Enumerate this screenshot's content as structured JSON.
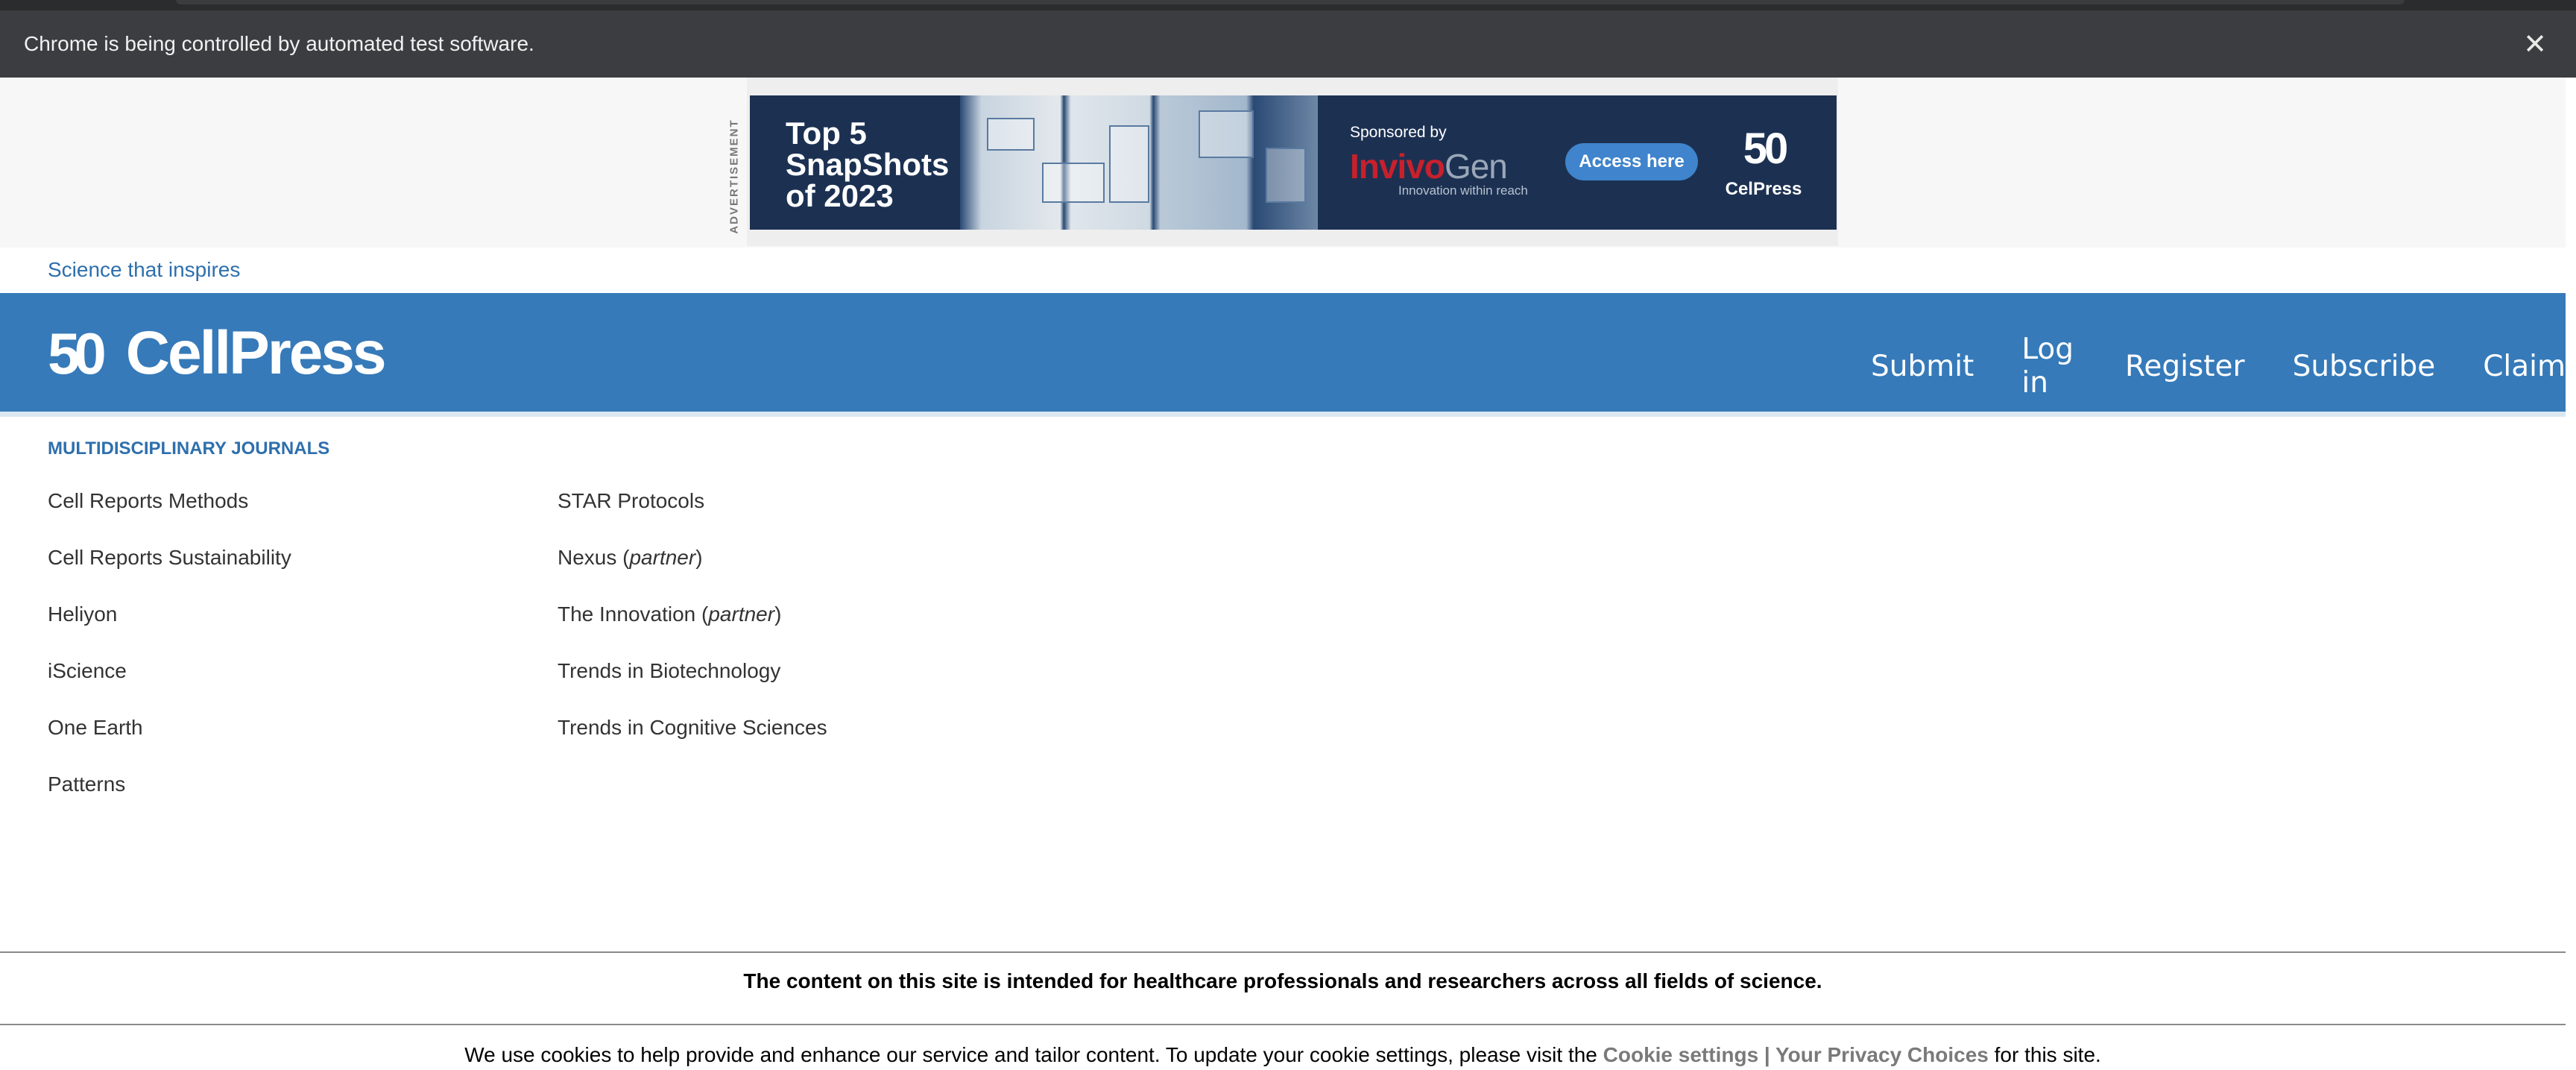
{
  "infobar": {
    "message": "Chrome is being controlled by automated test software.",
    "close_icon": "✕"
  },
  "advertisement": {
    "label": "ADVERTISEMENT",
    "headline": "Top 5 SnapShots of 2023",
    "sponsored_by": "Sponsored by",
    "sponsor_name_a": "Invivo",
    "sponsor_name_b": "Gen",
    "sponsor_tagline": "Innovation within reach",
    "cta": "Access here",
    "badge_mark": "50",
    "badge_name": "CelPress"
  },
  "tagline": "Science that inspires",
  "header": {
    "logo_mark": "50",
    "logo_text": "CellPress",
    "nav": [
      "Submit",
      "Log in",
      "Register",
      "Subscribe",
      "Claim"
    ]
  },
  "journals": {
    "section_title": "MULTIDISCIPLINARY JOURNALS",
    "col1": [
      "Cell Reports Methods",
      "Cell Reports Sustainability",
      "Heliyon",
      "iScience",
      "One Earth",
      "Patterns"
    ],
    "col2": [
      {
        "name": "STAR Protocols"
      },
      {
        "name": "Nexus (",
        "note": "partner",
        "tail": ")"
      },
      {
        "name": "The Innovation (",
        "note": "partner",
        "tail": ")"
      },
      {
        "name": "Trends in Biotechnology"
      },
      {
        "name": "Trends in Cognitive Sciences"
      }
    ]
  },
  "notice": "The content on this site is intended for healthcare professionals and researchers across all fields of science.",
  "cookie": {
    "text_before": "We use cookies to help provide and enhance our service and tailor content. To update your cookie settings, please visit the ",
    "link": "Cookie settings | Your Privacy Choices",
    "text_after": " for this site."
  },
  "colors": {
    "brand_blue": "#367ab9",
    "link_blue": "#2e6fad",
    "infobar_bg": "#3c3d40"
  }
}
